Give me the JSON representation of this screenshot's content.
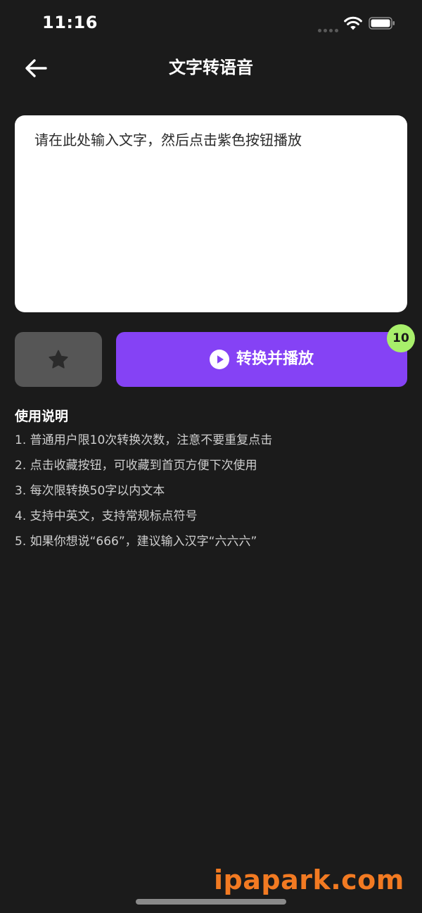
{
  "status_bar": {
    "time": "11:16",
    "icons": [
      "cellular-signal-icon",
      "wifi-icon",
      "battery-icon"
    ]
  },
  "nav": {
    "back_icon": "arrow-left-icon",
    "title": "文字转语音"
  },
  "input": {
    "value": "",
    "placeholder": "请在此处输入文字，然后点击紫色按钮播放"
  },
  "actions": {
    "favorite_icon": "star-icon",
    "play_icon": "play-circle-icon",
    "play_label": "转换并播放",
    "remaining_count": "10"
  },
  "instructions": {
    "title": "使用说明",
    "items": [
      "1. 普通用户限10次转换次数，注意不要重复点击",
      "2. 点击收藏按钮，可收藏到首页方便下次使用",
      "3. 每次限转换50字以内文本",
      "4. 支持中英文，支持常规标点符号",
      "5. 如果你想说“666”，建议输入汉字“六六六”"
    ]
  },
  "watermark": "ipapark.com",
  "colors": {
    "background": "#1b1b1b",
    "accent_purple": "#8542f5",
    "badge_green": "#a8ef6b",
    "favorite_gray": "#565656",
    "watermark_orange": "#f27a22"
  }
}
